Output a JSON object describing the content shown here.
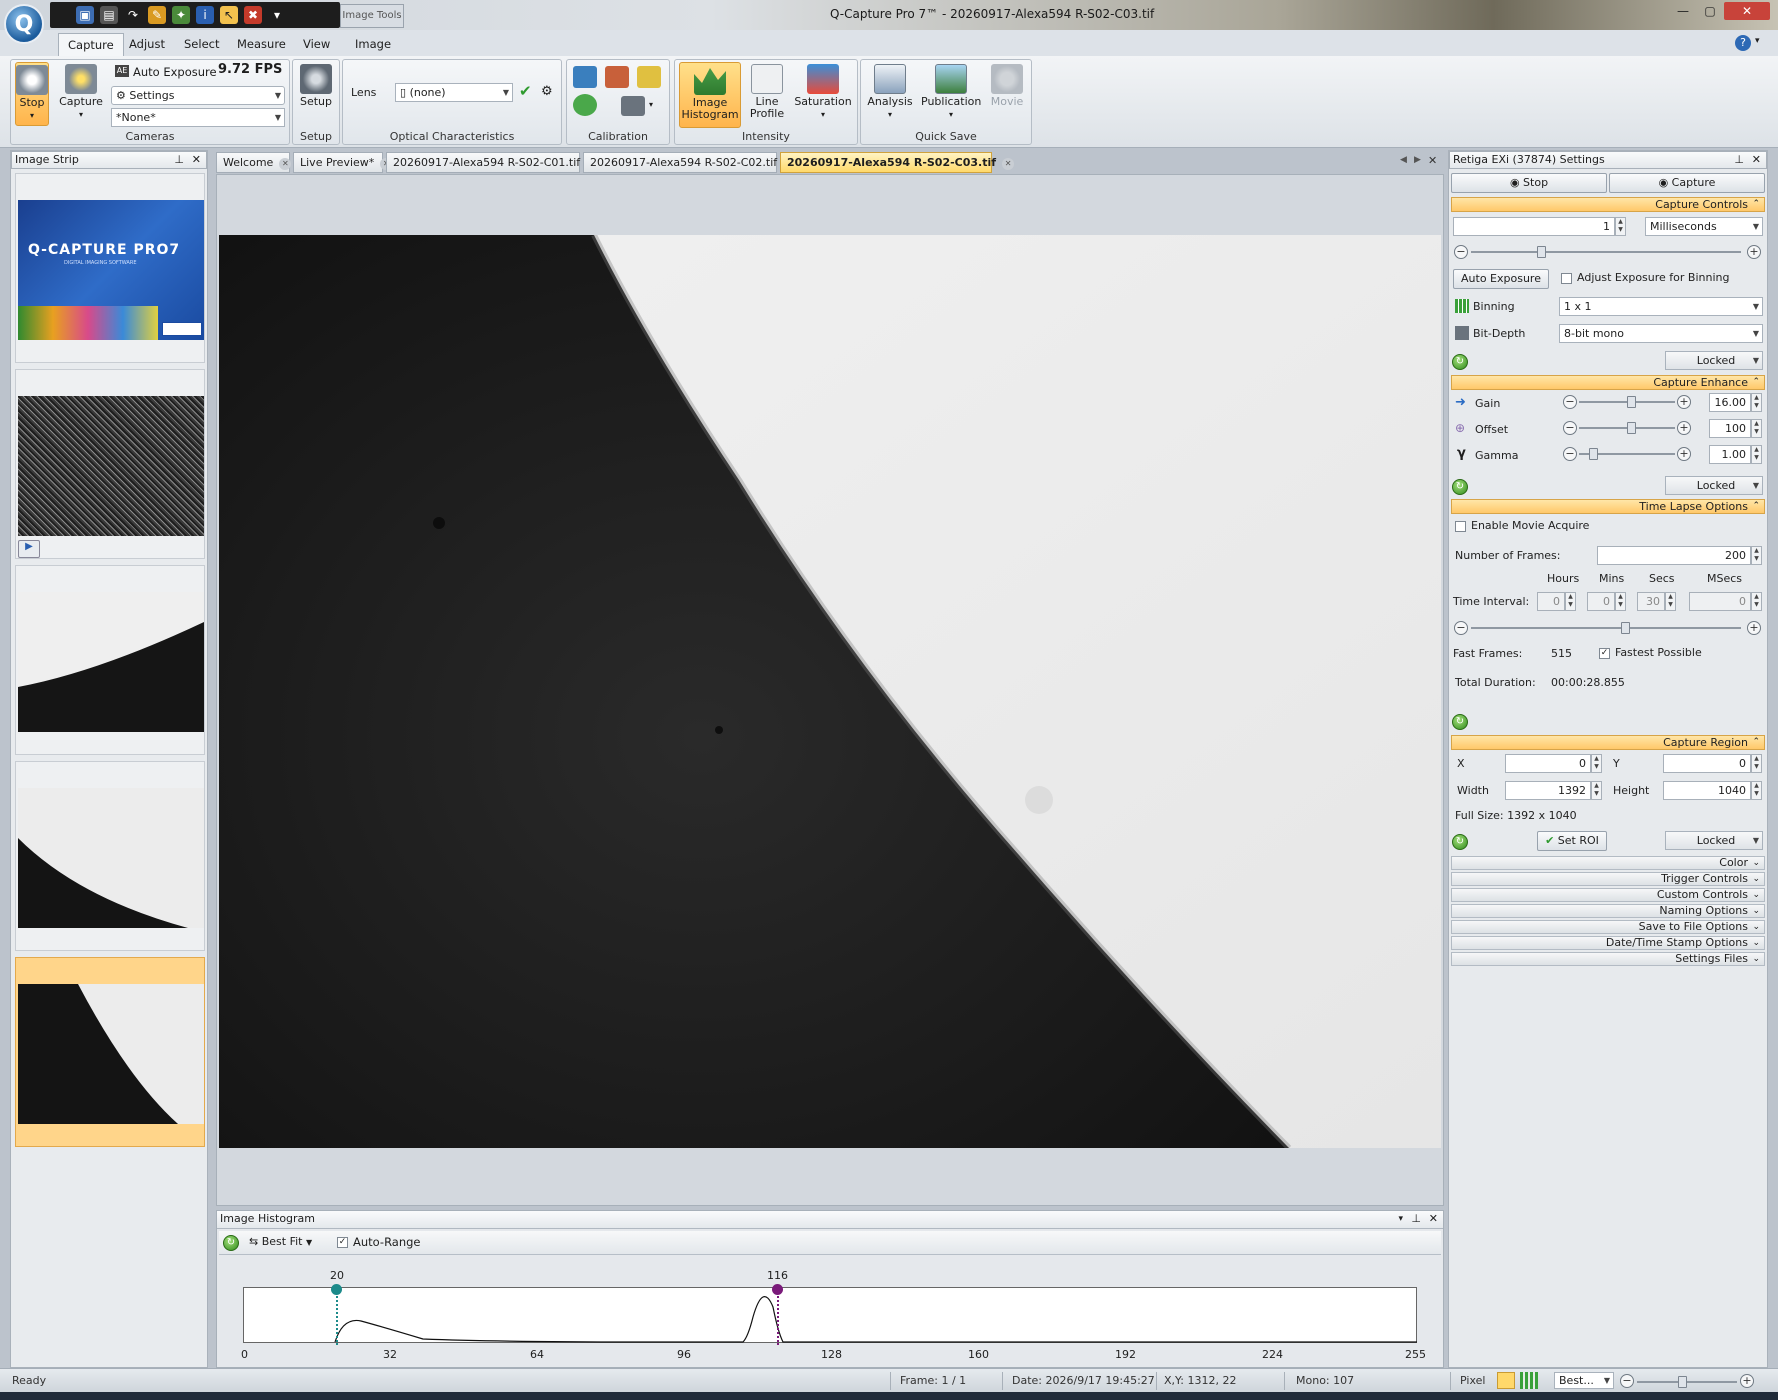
{
  "window": {
    "title": "Q-Capture Pro 7™ - 20260917-Alexa594 R-S02-C03.tif",
    "context_tab": "Image Tools",
    "logo_letter": "Q"
  },
  "ribbon": {
    "tabs": [
      "Capture",
      "Adjust",
      "Select",
      "Measure",
      "View",
      "Image"
    ],
    "active_tab": "Capture",
    "cameras": {
      "stop_label": "Stop",
      "capture_label": "Capture",
      "auto_exposure_label": "Auto Exposure",
      "fps": "9.72 FPS",
      "settings_label": "Settings",
      "preset_value": "*None*",
      "group_label": "Cameras"
    },
    "setup": {
      "button_label": "Setup",
      "group_label": "Setup"
    },
    "optical": {
      "lens_label": "Lens",
      "lens_value": "(none)",
      "group_label": "Optical Characteristics"
    },
    "calibration": {
      "group_label": "Calibration"
    },
    "intensity": {
      "histogram_label_1": "Image",
      "histogram_label_2": "Histogram",
      "line_profile_label_1": "Line",
      "line_profile_label_2": "Profile",
      "saturation_label": "Saturation",
      "group_label": "Intensity"
    },
    "quicksave": {
      "analysis_label": "Analysis",
      "publication_label": "Publication",
      "movie_label": "Movie",
      "group_label": "Quick Save"
    }
  },
  "image_strip": {
    "title": "Image Strip",
    "splash_title": "Q-CAPTURE PRO7",
    "splash_subtitle": "DIGITAL IMAGING SOFTWARE"
  },
  "doc_tabs": [
    "Welcome",
    "Live Preview*",
    "20260917-Alexa594 R-S02-C01.tif",
    "20260917-Alexa594 R-S02-C02.tif",
    "20260917-Alexa594 R-S02-C03.tif"
  ],
  "active_doc_tab": 4,
  "histogram": {
    "title": "Image Histogram",
    "fit_label": "Best Fit",
    "auto_range_label": "Auto-Range",
    "low_marker": "20",
    "high_marker": "116",
    "x_ticks": [
      "0",
      "32",
      "64",
      "96",
      "128",
      "160",
      "192",
      "224",
      "255"
    ]
  },
  "settings": {
    "title": "Retiga EXi (37874) Settings",
    "stop_label": "Stop",
    "capture_label": "Capture",
    "capture_controls": {
      "header": "Capture Controls",
      "exposure_value": "1",
      "exposure_unit": "Milliseconds",
      "auto_exposure_button": "Auto Exposure",
      "adjust_binning_label": "Adjust Exposure for Binning",
      "binning_label": "Binning",
      "binning_value": "1 x 1",
      "bitdepth_label": "Bit-Depth",
      "bitdepth_value": "8-bit mono",
      "locked_label": "Locked"
    },
    "capture_enhance": {
      "header": "Capture Enhance",
      "gain_label": "Gain",
      "gain_value": "16.00",
      "offset_label": "Offset",
      "offset_value": "100",
      "gamma_label": "Gamma",
      "gamma_value": "1.00",
      "locked_label": "Locked"
    },
    "time_lapse": {
      "header": "Time Lapse Options",
      "enable_movie_label": "Enable Movie Acquire",
      "frames_label": "Number of  Frames:",
      "frames_value": "200",
      "hours_label": "Hours",
      "mins_label": "Mins",
      "secs_label": "Secs",
      "msecs_label": "MSecs",
      "interval_label": "Time Interval:",
      "hours_value": "0",
      "mins_value": "0",
      "secs_value": "30",
      "msecs_value": "0",
      "fast_frames_label": "Fast Frames:",
      "fast_frames_value": "515",
      "fastest_label": "Fastest Possible",
      "total_duration_label": "Total Duration:",
      "total_duration_value": "00:00:28.855"
    },
    "capture_region": {
      "header": "Capture Region",
      "x_label": "X",
      "x_value": "0",
      "y_label": "Y",
      "y_value": "0",
      "width_label": "Width",
      "width_value": "1392",
      "height_label": "Height",
      "height_value": "1040",
      "full_size": "Full Size: 1392 x 1040",
      "set_roi_label": "Set ROI",
      "locked_label": "Locked"
    },
    "collapsed_sections": [
      "Color",
      "Trigger Controls",
      "Custom Controls",
      "Naming Options",
      "Save to File Options",
      "Date/Time Stamp Options",
      "Settings Files"
    ]
  },
  "status": {
    "ready": "Ready",
    "frame": "Frame: 1 / 1",
    "date": "Date: 2026/9/17 19:45:27",
    "xy": "X,Y: 1312,   22",
    "mono": "Mono:   107",
    "pixel": "Pixel",
    "zoom_label": "Best..."
  }
}
